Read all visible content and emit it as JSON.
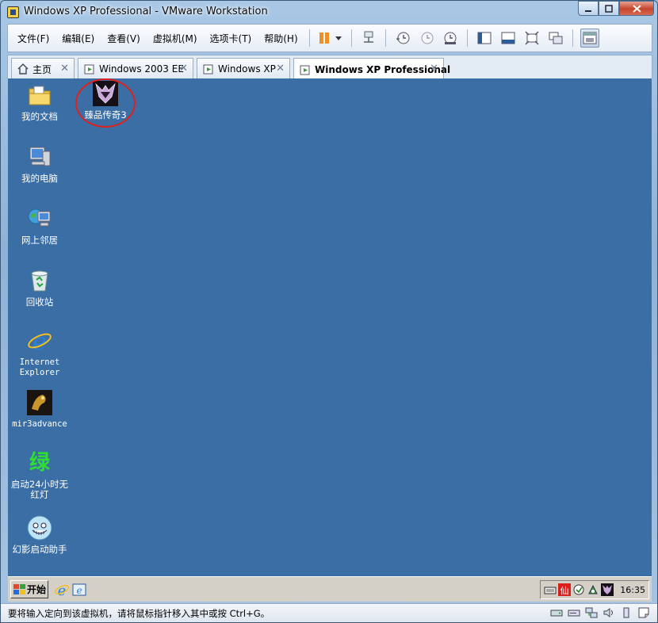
{
  "window": {
    "title": "Windows XP Professional - VMware Workstation"
  },
  "menu": [
    "文件(F)",
    "编辑(E)",
    "查看(V)",
    "虚拟机(M)",
    "选项卡(T)",
    "帮助(H)"
  ],
  "tabs": [
    {
      "label": "主页",
      "icon": "home-icon"
    },
    {
      "label": "Windows 2003 EE",
      "icon": "vm-icon"
    },
    {
      "label": "Windows XP",
      "icon": "vm-icon"
    },
    {
      "label": "Windows XP Professional",
      "icon": "vm-icon",
      "active": true
    }
  ],
  "desktop": {
    "background_color": "#3a6ea5",
    "icons": [
      {
        "label": "我的文档",
        "icon": "my-documents-icon"
      },
      {
        "label": "我的电脑",
        "icon": "my-computer-icon"
      },
      {
        "label": "网上邻居",
        "icon": "network-places-icon"
      },
      {
        "label": "回收站",
        "icon": "recycle-bin-icon"
      },
      {
        "label": "Internet Explorer",
        "icon": "internet-explorer-icon"
      },
      {
        "label": "mir3advance",
        "icon": "mir3advance-icon"
      },
      {
        "label": "启动24小时无红灯",
        "glyph": "绿",
        "icon": "green-char-icon"
      },
      {
        "label": "幻影启动助手",
        "icon": "phantom-launcher-icon"
      },
      {
        "label": "臻品传奇3",
        "icon": "game-launcher-icon",
        "highlighted": true
      }
    ]
  },
  "taskbar": {
    "start_label": "开始",
    "clock": "16:35"
  },
  "statusbar": {
    "message": "要将输入定向到该虚拟机，请将鼠标指针移入其中或按 Ctrl+G。"
  }
}
